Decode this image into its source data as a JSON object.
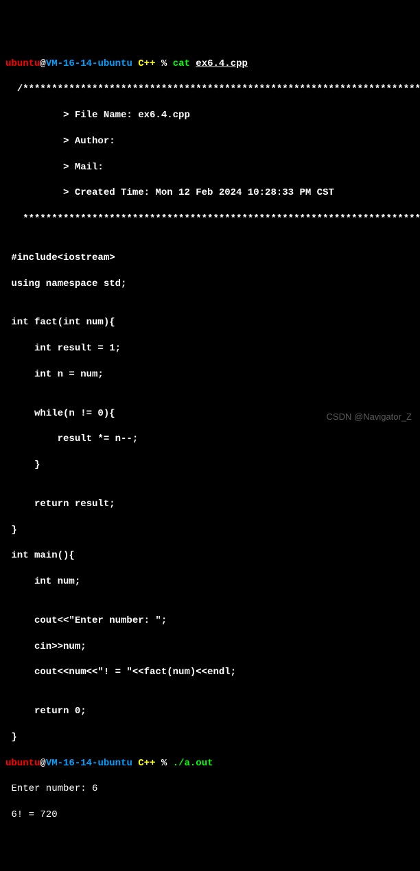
{
  "prompt1": {
    "user": "ubuntu",
    "at": "@",
    "host": "VM-16-14-ubuntu",
    "dir": " C++",
    "pct": " % ",
    "cmd": "cat ",
    "arg": "ex6.4.cpp"
  },
  "header": {
    "top": "  /*************************************************************************",
    "l1": "          > File Name: ex6.4.cpp",
    "l2": "          > Author:",
    "l3": "          > Mail:",
    "l4": "          > Created Time: Mon 12 Feb 2024 10:28:33 PM CST",
    "bottom": "   ************************************************************************/"
  },
  "code": {
    "c0": "",
    "c1": " #include<iostream>",
    "c2": " using namespace std;",
    "c3": "",
    "c4": " int fact(int num){",
    "c5": "     int result = 1;",
    "c6": "     int n = num;",
    "c7": "",
    "c8": "     while(n != 0){",
    "c9": "         result *= n--;",
    "c10": "     }",
    "c11": "",
    "c12": "     return result;",
    "c13": " }",
    "c14": " int main(){",
    "c15": "     int num;",
    "c16": "",
    "c17": "     cout<<\"Enter number: \";",
    "c18": "     cin>>num;",
    "c19": "     cout<<num<<\"! = \"<<fact(num)<<endl;",
    "c20": "",
    "c21": "     return 0;",
    "c22": " }"
  },
  "prompt2": {
    "user": "ubuntu",
    "at": "@",
    "host": "VM-16-14-ubuntu",
    "dir": " C++",
    "pct": " % ",
    "cmd": "./a.out"
  },
  "run": {
    "l1": " Enter number: 6",
    "l2": " 6! = 720"
  },
  "watermark": "CSDN @Navigator_Z"
}
